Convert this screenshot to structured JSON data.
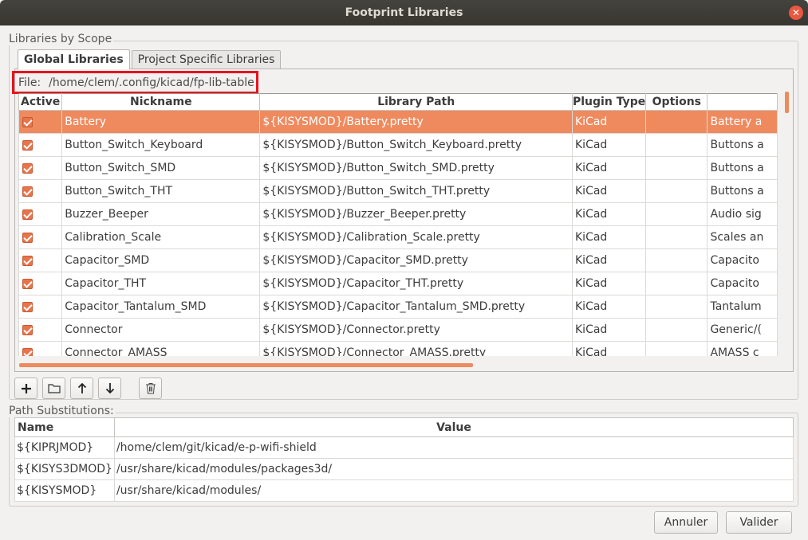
{
  "window": {
    "title": "Footprint Libraries"
  },
  "scope_group": {
    "label": "Libraries by Scope",
    "tabs": [
      {
        "label": "Global Libraries",
        "active": true
      },
      {
        "label": "Project Specific Libraries",
        "active": false
      }
    ],
    "file_label": "File:",
    "file_path": "/home/clem/.config/kicad/fp-lib-table"
  },
  "library_table": {
    "columns": [
      "Active",
      "Nickname",
      "Library Path",
      "Plugin Type",
      "Options",
      ""
    ],
    "rows": [
      {
        "active": true,
        "nickname": "Battery",
        "path": "${KISYSMOD}/Battery.pretty",
        "plugin": "KiCad",
        "options": "",
        "description": "Battery a",
        "selected": true
      },
      {
        "active": true,
        "nickname": "Button_Switch_Keyboard",
        "path": "${KISYSMOD}/Button_Switch_Keyboard.pretty",
        "plugin": "KiCad",
        "options": "",
        "description": "Buttons a",
        "selected": false
      },
      {
        "active": true,
        "nickname": "Button_Switch_SMD",
        "path": "${KISYSMOD}/Button_Switch_SMD.pretty",
        "plugin": "KiCad",
        "options": "",
        "description": "Buttons a",
        "selected": false
      },
      {
        "active": true,
        "nickname": "Button_Switch_THT",
        "path": "${KISYSMOD}/Button_Switch_THT.pretty",
        "plugin": "KiCad",
        "options": "",
        "description": "Buttons a",
        "selected": false
      },
      {
        "active": true,
        "nickname": "Buzzer_Beeper",
        "path": "${KISYSMOD}/Buzzer_Beeper.pretty",
        "plugin": "KiCad",
        "options": "",
        "description": "Audio sig",
        "selected": false
      },
      {
        "active": true,
        "nickname": "Calibration_Scale",
        "path": "${KISYSMOD}/Calibration_Scale.pretty",
        "plugin": "KiCad",
        "options": "",
        "description": "Scales an",
        "selected": false
      },
      {
        "active": true,
        "nickname": "Capacitor_SMD",
        "path": "${KISYSMOD}/Capacitor_SMD.pretty",
        "plugin": "KiCad",
        "options": "",
        "description": "Capacito",
        "selected": false
      },
      {
        "active": true,
        "nickname": "Capacitor_THT",
        "path": "${KISYSMOD}/Capacitor_THT.pretty",
        "plugin": "KiCad",
        "options": "",
        "description": "Capacito",
        "selected": false
      },
      {
        "active": true,
        "nickname": "Capacitor_Tantalum_SMD",
        "path": "${KISYSMOD}/Capacitor_Tantalum_SMD.pretty",
        "plugin": "KiCad",
        "options": "",
        "description": "Tantalum",
        "selected": false
      },
      {
        "active": true,
        "nickname": "Connector",
        "path": "${KISYSMOD}/Connector.pretty",
        "plugin": "KiCad",
        "options": "",
        "description": "Generic/(",
        "selected": false
      },
      {
        "active": true,
        "nickname": "Connector_AMASS",
        "path": "${KISYSMOD}/Connector_AMASS.pretty",
        "plugin": "KiCad",
        "options": "",
        "description": "AMASS c",
        "selected": false
      }
    ]
  },
  "toolbar": {
    "buttons": [
      {
        "name": "add-library-button",
        "icon": "plus-icon"
      },
      {
        "name": "browse-library-button",
        "icon": "folder-icon"
      },
      {
        "name": "move-up-button",
        "icon": "arrow-up-icon"
      },
      {
        "name": "move-down-button",
        "icon": "arrow-down-icon"
      },
      {
        "name": "delete-library-button",
        "icon": "trash-icon"
      }
    ]
  },
  "path_substitutions": {
    "label": "Path Substitutions:",
    "columns": [
      "Name",
      "Value"
    ],
    "rows": [
      {
        "name": "${KIPRJMOD}",
        "value": "/home/clem/git/kicad/e-p-wifi-shield"
      },
      {
        "name": "${KISYS3DMOD}",
        "value": "/usr/share/kicad/modules/packages3d/"
      },
      {
        "name": "${KISYSMOD}",
        "value": "/usr/share/kicad/modules/"
      }
    ]
  },
  "footer": {
    "cancel_label": "Annuler",
    "ok_label": "Valider"
  },
  "colors": {
    "accent": "#ef8a5e",
    "highlight_border": "#e8121e",
    "titlebar": "#3c3b37",
    "close_button": "#e9573f"
  }
}
